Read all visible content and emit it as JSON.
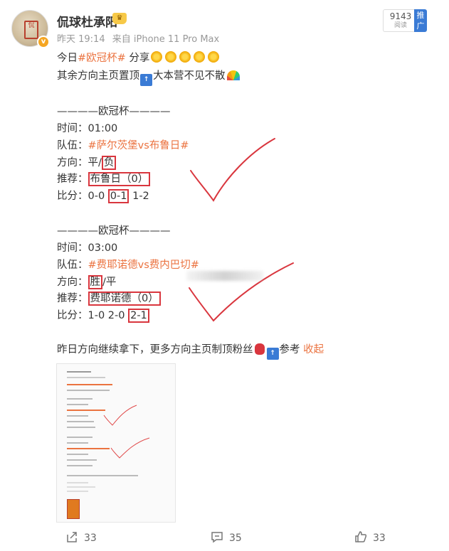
{
  "header": {
    "username": "侃球杜承阳",
    "time": "昨天 19:14",
    "source": "来自 iPhone 11 Pro Max",
    "read_count": "9143",
    "read_label": "阅读",
    "promo_label": "推广"
  },
  "post": {
    "line1_prefix": "今日",
    "line1_tag": "#欧冠杯#",
    "line1_suffix": " 分享",
    "line2_text": "其余方向主页置顶",
    "line2_suffix": "大本营不见不散",
    "match1": {
      "divider": "————欧冠杯————",
      "time_label": "时间：",
      "time_value": "01:00",
      "team_label": "队伍：",
      "team_value": "#萨尔茨堡vs布鲁日#",
      "dir_label": "方向：",
      "dir_plain": "平/",
      "dir_boxed": "负",
      "rec_label": "推荐：",
      "rec_boxed": "布鲁日（0）",
      "score_label": "比分：",
      "score_a": "0-0 ",
      "score_boxed": "0-1",
      "score_b": " 1-2"
    },
    "match2": {
      "divider": "————欧冠杯————",
      "time_label": "时间：",
      "time_value": "03:00",
      "team_label": "队伍：",
      "team_value": "#费耶诺德vs费内巴切#",
      "dir_label": "方向：",
      "dir_boxed": "胜",
      "dir_plain": "/平",
      "rec_label": "推荐：",
      "rec_boxed": "费耶诺德（0）",
      "score_label": "比分：",
      "score_a": "1-0 2-0 ",
      "score_boxed": "2-1"
    },
    "closing_text": "昨日方向继续拿下，更多方向主页制顶粉丝",
    "closing_suffix": "参考",
    "collapse_link": "收起"
  },
  "footer": {
    "share_count": "33",
    "comment_count": "35",
    "like_count": "33"
  },
  "icons": {
    "share": "share-icon",
    "comment": "comment-icon",
    "like": "thumbs-up-icon"
  },
  "colors": {
    "tag": "#eb7340",
    "box": "#d9363e",
    "check": "#d9363e"
  }
}
